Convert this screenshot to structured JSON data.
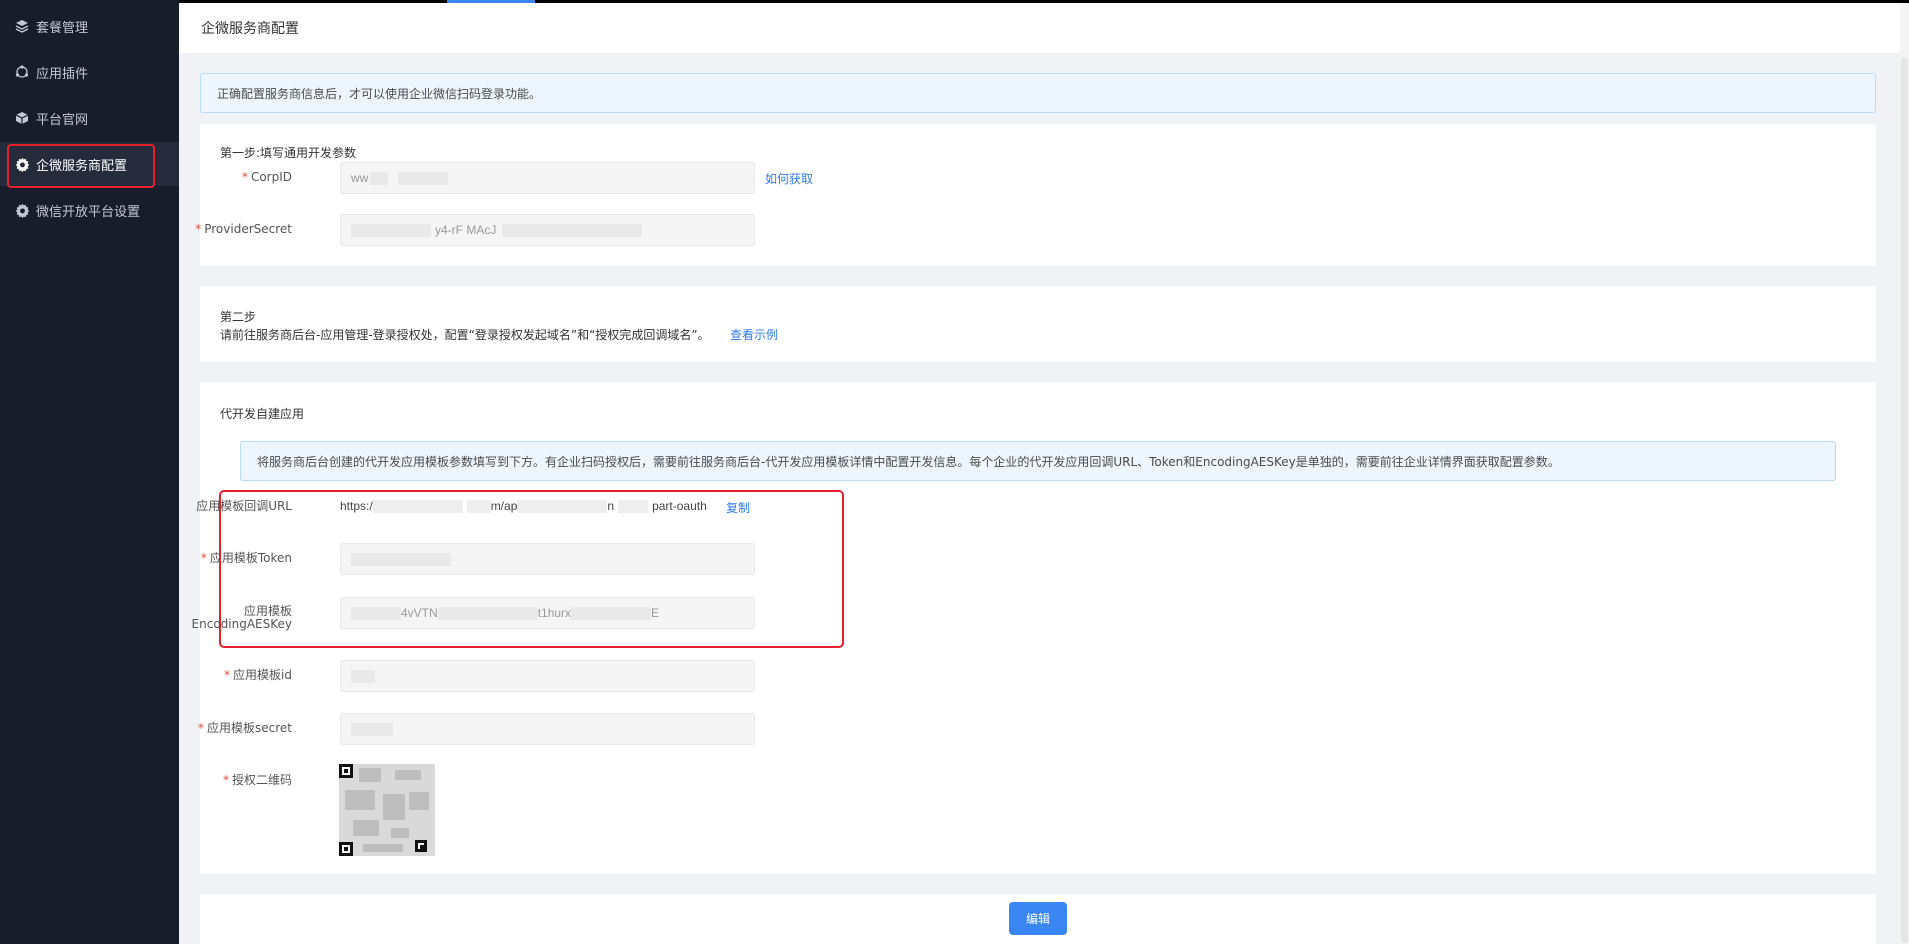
{
  "sidebar": {
    "items": [
      {
        "label": "套餐管理",
        "icon": "layers-icon"
      },
      {
        "label": "应用插件",
        "icon": "plugin-icon"
      },
      {
        "label": "平台官网",
        "icon": "cube-icon"
      },
      {
        "label": "企微服务商配置",
        "icon": "gear-icon",
        "active": true
      },
      {
        "label": "微信开放平台设置",
        "icon": "gear-icon"
      }
    ]
  },
  "header": {
    "title": "企微服务商配置"
  },
  "notice": "正确配置服务商信息后，才可以使用企业微信扫码登录功能。",
  "step1": {
    "title": "第一步:填写通用开发参数",
    "corpid": {
      "label": "CorpID",
      "value": "ww",
      "help_link": "如何获取"
    },
    "provider_secret": {
      "label": "ProviderSecret",
      "value": "y4-rF MAcJ"
    }
  },
  "step2": {
    "title": "第二步",
    "description": "请前往服务商后台-应用管理-登录授权处，配置“登录授权发起域名”和“授权完成回调域名”。",
    "example_link": "查看示例"
  },
  "custom_app": {
    "title": "代开发自建应用",
    "notice": "将服务商后台创建的代开发应用模板参数填写到下方。有企业扫码授权后，需要前往服务商后台-代开发应用模板详情中配置开发信息。每个企业的代开发应用回调URL、Token和EncodingAESKey是单独的，需要前往企业详情界面获取配置参数。",
    "callback_url": {
      "label": "应用模板回调URL",
      "prefix": "https:/",
      "mid1": "m/ap",
      "mid2": "n",
      "suffix": "part-oauth",
      "copy_label": "复制"
    },
    "token": {
      "label": "应用模板Token"
    },
    "aes_key": {
      "label_line1": "应用模板",
      "label_line2": "EncodingAESKey",
      "part1": "4vVTN",
      "part2": "t1hurx",
      "part3": "E"
    },
    "template_id": {
      "label": "应用模板id"
    },
    "template_secret": {
      "label": "应用模板secret"
    },
    "qr": {
      "label": "授权二维码"
    }
  },
  "actions": {
    "edit_label": "编辑"
  },
  "colors": {
    "primary": "#3a86f4",
    "sidebar_bg": "#181d2b",
    "highlight": "#e3202c"
  }
}
